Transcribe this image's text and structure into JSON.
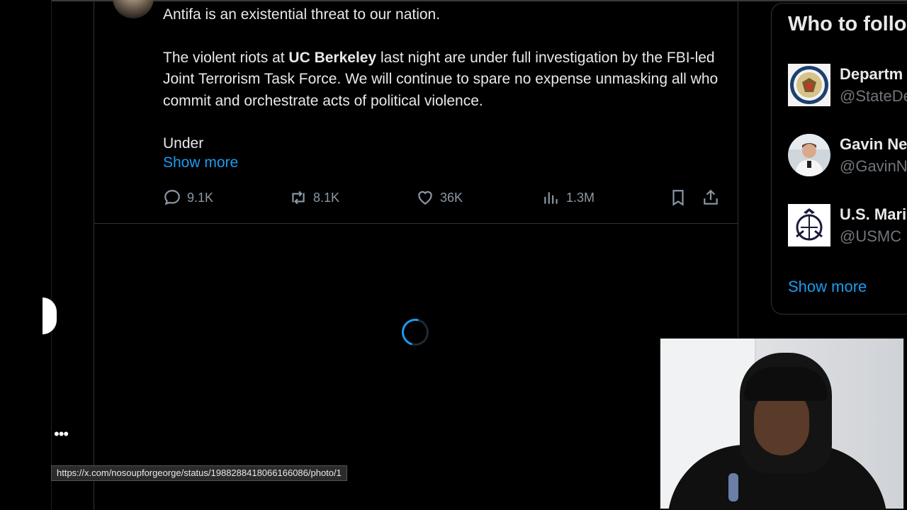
{
  "tweet": {
    "line1": "Antifa is an existential threat to our nation.",
    "para2_pre": "The violent riots at ",
    "para2_bold": "UC Berkeley",
    "para2_post": " last night are under full investigation by the FBI-led Joint Terrorism Task Force. We will continue to spare no expense unmasking all who commit and orchestrate acts of political violence.",
    "line3": "Under",
    "show_more": "Show more"
  },
  "actions": {
    "replies": "9.1K",
    "reposts": "8.1K",
    "likes": "36K",
    "views": "1.3M"
  },
  "status_url": "https://x.com/nosoupforgeorge/status/1988288418066166086/photo/1",
  "who_to_follow": {
    "title": "Who to follo",
    "accounts": [
      {
        "name": "Departm",
        "handle": "@StateDe",
        "icon": "state-department-seal-icon"
      },
      {
        "name": "Gavin Ne",
        "handle": "@GavinN",
        "icon": "person-avatar"
      },
      {
        "name": "U.S. Mari",
        "handle": "@USMC",
        "icon": "usmc-emblem-icon"
      }
    ],
    "show_more": "Show more"
  },
  "more_menu": "•••",
  "colors": {
    "accent": "#1d9bf0",
    "muted": "#8b98a5",
    "border": "#2f3336",
    "background": "#000000"
  }
}
